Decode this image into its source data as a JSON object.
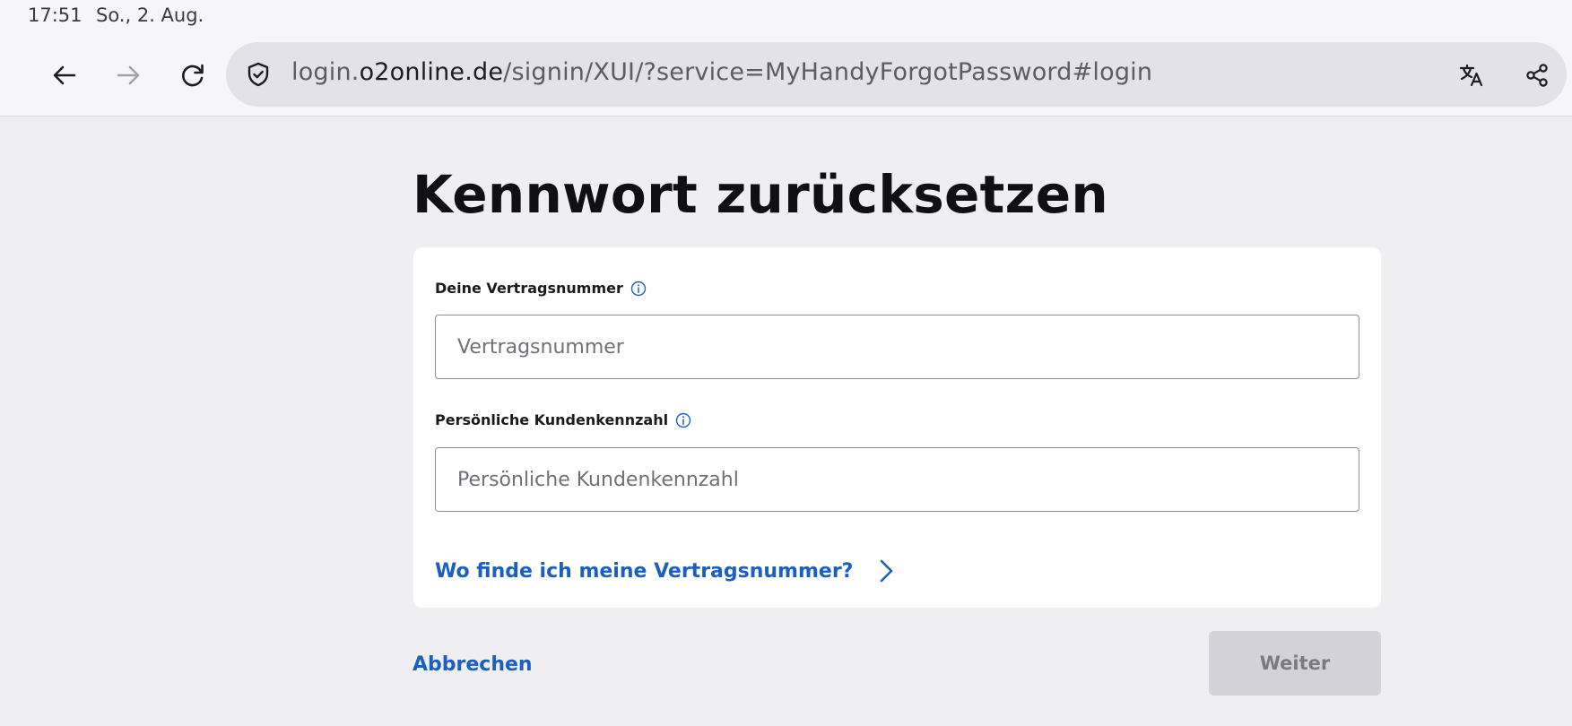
{
  "status_bar": {
    "time": "17:51",
    "date": "So., 2. Aug."
  },
  "browser": {
    "url_domain_prefix": "login.",
    "url_domain": "o2online.de",
    "url_path": "/signin/XUI/?service=MyHandyForgotPassword#login",
    "icons": [
      "back-arrow-icon",
      "forward-arrow-icon",
      "reload-icon",
      "shield-check-icon",
      "translate-icon",
      "share-icon"
    ]
  },
  "page": {
    "title": "Kennwort zurücksetzen",
    "contract_number_label": "Deine Vertragsnummer",
    "contract_number_placeholder": "Vertragsnummer",
    "customer_id_label": "Persönliche Kundenkennzahl",
    "customer_id_placeholder": "Persönliche Kundenkennzahl",
    "help_link": "Wo finde ich meine Vertragsnummer?",
    "cancel_label": "Abbrechen",
    "next_label": "Weiter"
  },
  "colors": {
    "link": "#1b5fc1",
    "page_bg": "#efeff2",
    "button_disabled_bg": "#d2d2d8",
    "button_disabled_text": "#7a7a82"
  }
}
